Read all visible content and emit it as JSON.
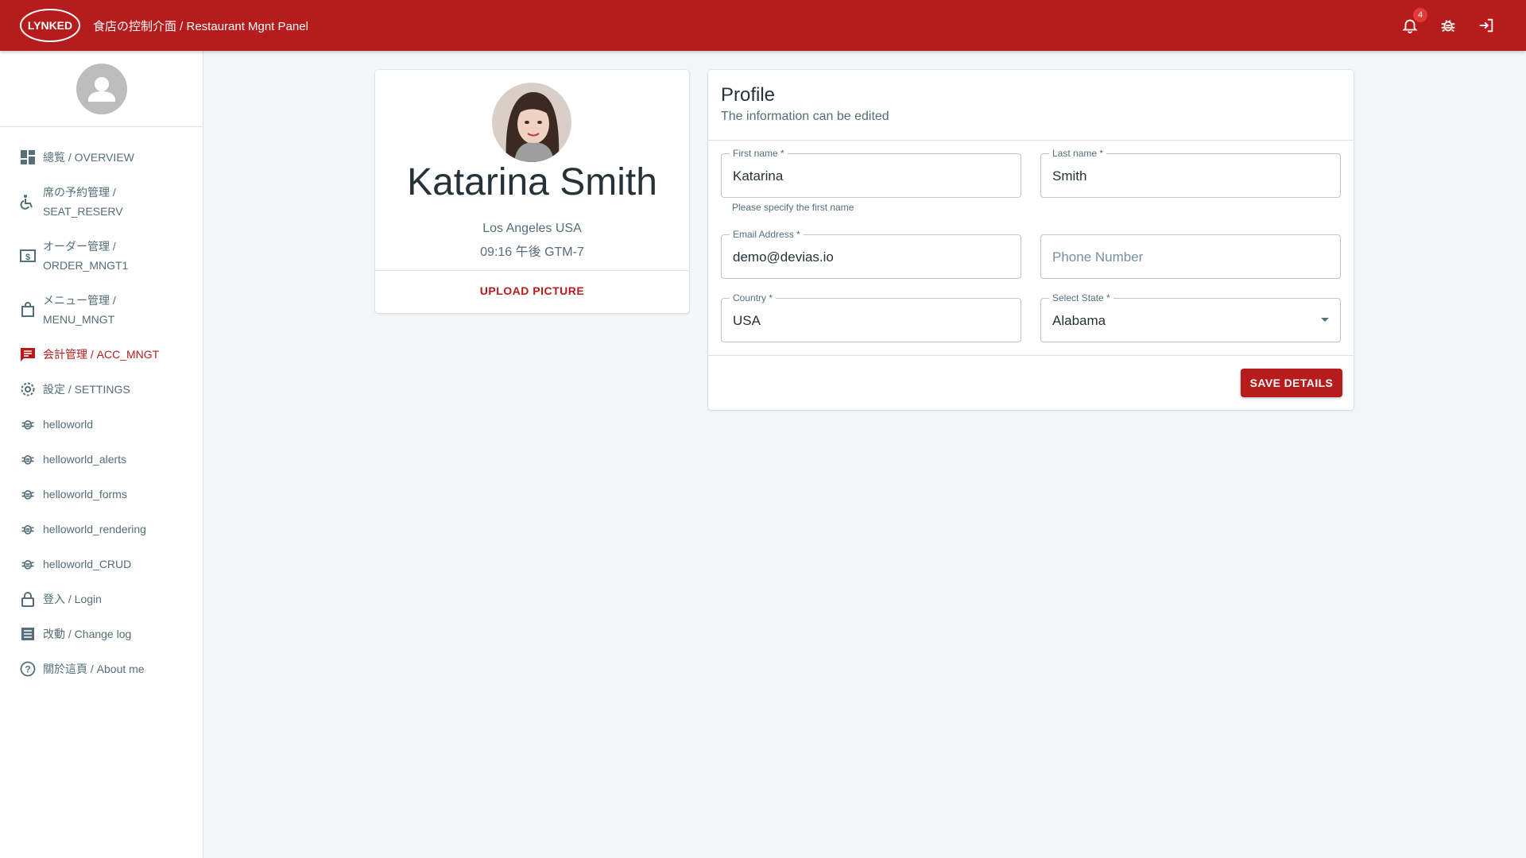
{
  "header": {
    "logo_text": "LYNKED",
    "title": "食店の控制介面 / Restaurant Mgnt Panel",
    "notification_count": "4",
    "icons": [
      "bell-icon",
      "bug-icon",
      "logout-icon"
    ]
  },
  "sidebar": {
    "items": [
      {
        "label": "總覧 / OVERVIEW",
        "icon": "dashboard-icon"
      },
      {
        "label": "席の予約管理 / SEAT_RESERV",
        "icon": "wheelchair-icon"
      },
      {
        "label": "オーダー管理 / ORDER_MNGT1",
        "icon": "money-icon"
      },
      {
        "label": "メニュー管理 / MENU_MNGT",
        "icon": "bag-icon"
      },
      {
        "label": "会計管理 / ACC_MNGT",
        "icon": "chat-icon"
      },
      {
        "label": "設定 / SETTINGS",
        "icon": "gear-icon"
      },
      {
        "label": "helloworld",
        "icon": "bug-icon"
      },
      {
        "label": "helloworld_alerts",
        "icon": "bug-icon"
      },
      {
        "label": "helloworld_forms",
        "icon": "bug-icon"
      },
      {
        "label": "helloworld_rendering",
        "icon": "bug-icon"
      },
      {
        "label": "helloworld_CRUD",
        "icon": "bug-icon"
      },
      {
        "label": "登入 / Login",
        "icon": "lock-icon"
      },
      {
        "label": "改動 / Change log",
        "icon": "list-icon"
      },
      {
        "label": "關於這頁 / About me",
        "icon": "help-icon"
      }
    ],
    "active_index": 4
  },
  "profile_card": {
    "name": "Katarina Smith",
    "location": "Los Angeles USA",
    "time": "09:16 午後 GTM-7",
    "upload_label": "UPLOAD PICTURE"
  },
  "profile_form": {
    "title": "Profile",
    "subtitle": "The information can be edited",
    "first_name_label": "First name *",
    "first_name_value": "Katarina",
    "first_name_helper": "Please specify the first name",
    "last_name_label": "Last name *",
    "last_name_value": "Smith",
    "email_label": "Email Address *",
    "email_value": "demo@devias.io",
    "phone_placeholder": "Phone Number",
    "country_label": "Country *",
    "country_value": "USA",
    "state_label": "Select State *",
    "state_value": "Alabama",
    "save_label": "SAVE DETAILS"
  },
  "colors": {
    "brand": "#b71c1c",
    "background": "#f4f6f8",
    "badge": "#e53935"
  }
}
